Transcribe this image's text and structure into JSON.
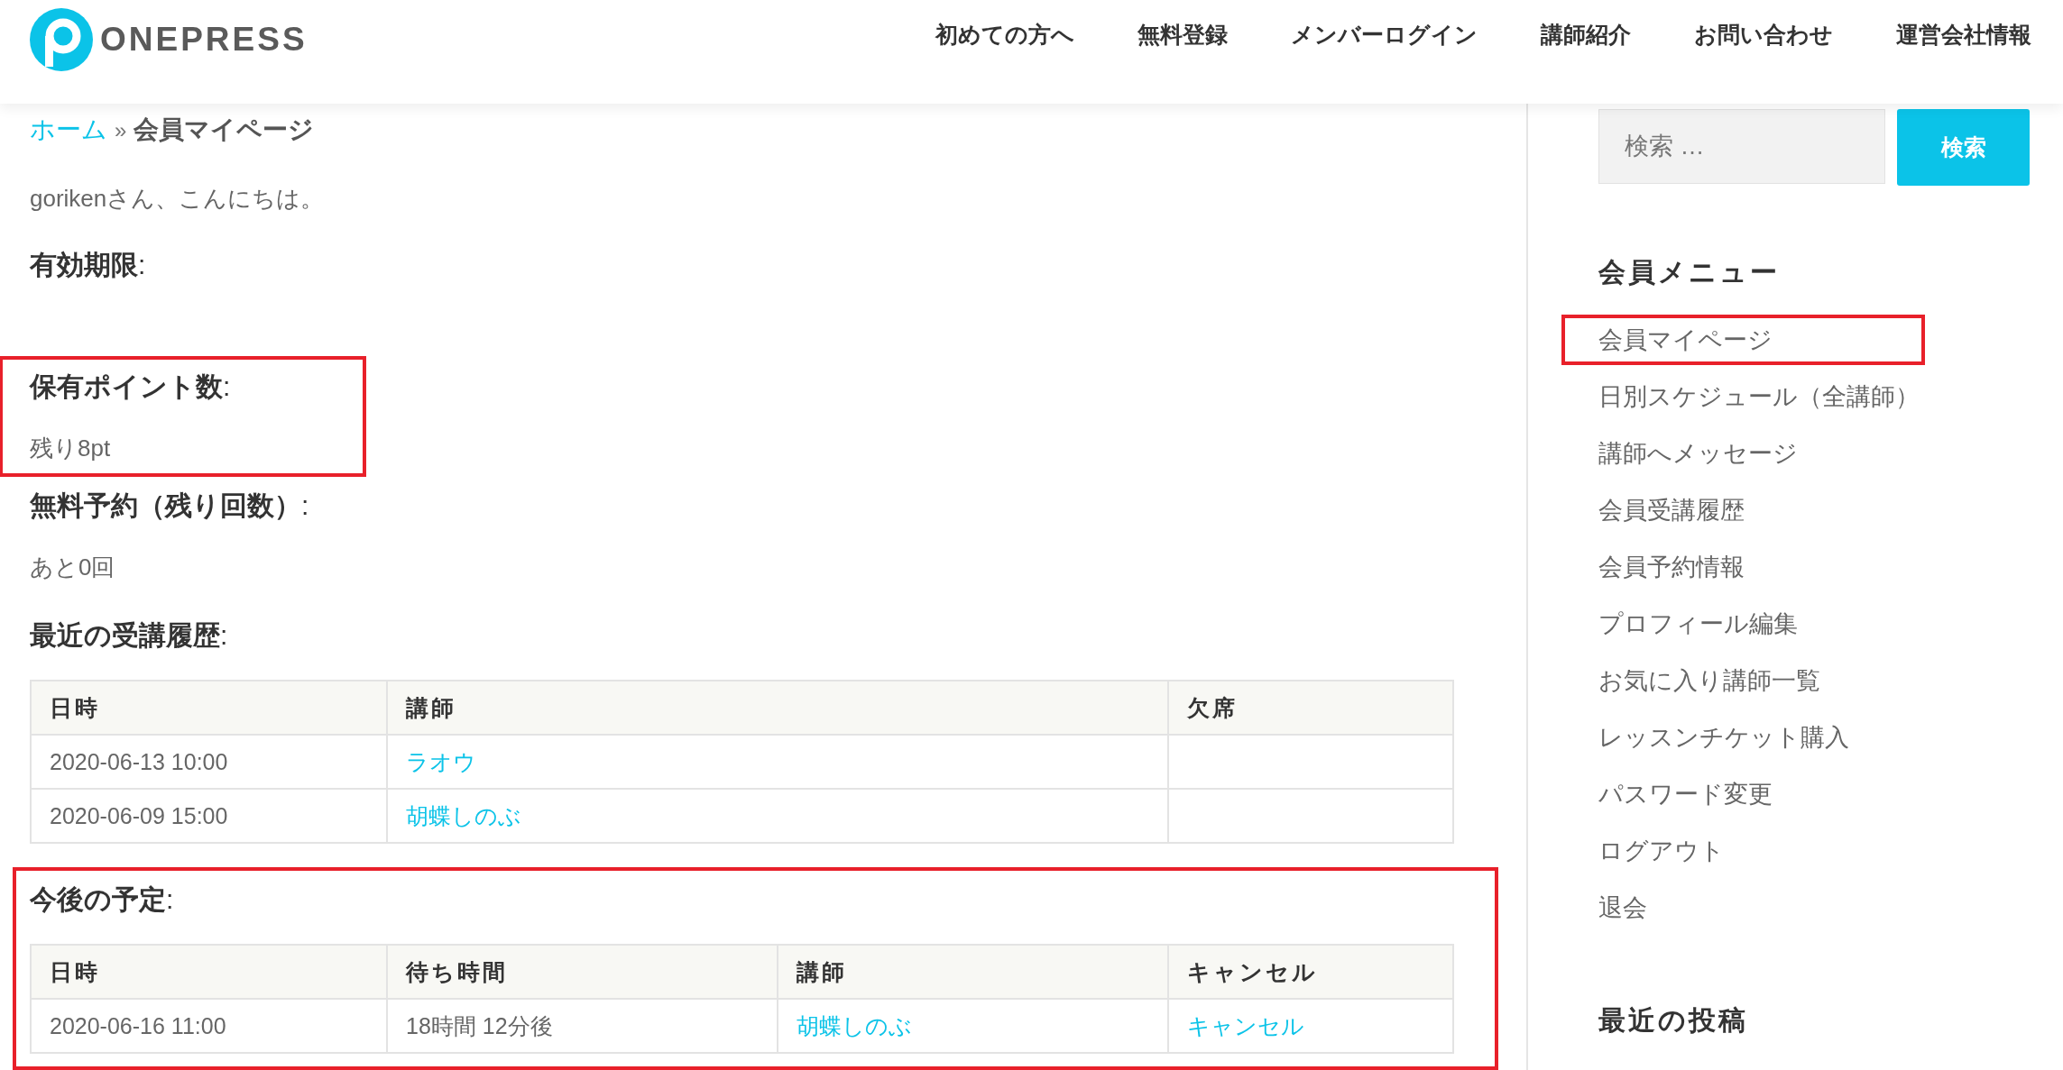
{
  "header": {
    "logo_text": "ONEPRESS",
    "nav": [
      {
        "label": "初めての方へ"
      },
      {
        "label": "無料登録"
      },
      {
        "label": "メンバーログイン"
      },
      {
        "label": "講師紹介"
      },
      {
        "label": "お問い合わせ"
      },
      {
        "label": "運営会社情報"
      }
    ]
  },
  "breadcrumb": {
    "home": "ホーム",
    "separator": "»",
    "current": "会員マイページ"
  },
  "greeting": "gorikenさん、こんにちは。",
  "sections": [
    {
      "kind": "field",
      "heading": "**有効期限**:",
      "highlighted": false
    },
    {
      "kind": "field",
      "heading": "**保有ポイント数**:",
      "value": "残り8pt",
      "highlighted": true
    },
    {
      "kind": "field",
      "heading": "**無料予約（残り回数）**:",
      "value": "あと0回",
      "highlighted": false
    },
    {
      "kind": "table",
      "heading": "**最近の受講履歴**:",
      "highlighted": false,
      "columns": [
        "日時",
        "講師",
        "欠席"
      ],
      "rows": [
        [
          {
            "text": "2020-06-13 10:00",
            "link": false
          },
          {
            "text": "ラオウ",
            "link": true
          }
        ],
        [
          {
            "text": "2020-06-09 15:00",
            "link": false
          },
          {
            "text": "胡蝶しのぶ",
            "link": true
          }
        ]
      ]
    },
    {
      "kind": "table",
      "heading": "**今後の予定**:",
      "highlighted": true,
      "columns": [
        "日時",
        "待ち時間",
        "講師",
        "キャンセル"
      ],
      "rows": [
        [
          {
            "text": "2020-06-16 11:00",
            "link": false
          },
          {
            "text": "18時間 12分後",
            "link": false
          },
          {
            "text": "胡蝶しのぶ",
            "link": true
          },
          {
            "text": "キャンセル",
            "link": true
          }
        ]
      ]
    }
  ],
  "sidebar": {
    "search": {
      "placeholder": "検索 …",
      "button": "検索"
    },
    "menu_title": "会員メニュー",
    "menu": [
      {
        "label": "会員マイページ",
        "highlighted": true
      },
      {
        "label": "日別スケジュール（全講師）",
        "highlighted": false
      },
      {
        "label": "講師へメッセージ",
        "highlighted": false
      },
      {
        "label": "会員受講履歴",
        "highlighted": false
      },
      {
        "label": "会員予約情報",
        "highlighted": false
      },
      {
        "label": "プロフィール編集",
        "highlighted": false
      },
      {
        "label": "お気に入り講師一覧",
        "highlighted": false
      },
      {
        "label": "レッスンチケット購入",
        "highlighted": false
      },
      {
        "label": "パスワード変更",
        "highlighted": false
      },
      {
        "label": "ログアウト",
        "highlighted": false
      },
      {
        "label": "退会",
        "highlighted": false
      }
    ],
    "recent_title": "最近の投稿"
  }
}
